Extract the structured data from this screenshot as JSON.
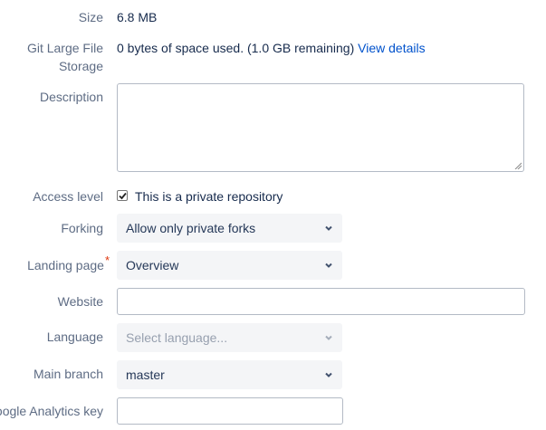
{
  "size": {
    "label": "Size",
    "value": "6.8 MB"
  },
  "lfs": {
    "label_line1": "Git Large File",
    "label_line2": "Storage",
    "value": "0 bytes of space used. (1.0 GB remaining)",
    "link": "View details"
  },
  "description": {
    "label": "Description",
    "value": ""
  },
  "access_level": {
    "label": "Access level",
    "checkbox_label": "This is a private repository",
    "checked": true
  },
  "forking": {
    "label": "Forking",
    "selected": "Allow only private forks"
  },
  "landing_page": {
    "label": "Landing page",
    "required_mark": "*",
    "selected": "Overview"
  },
  "website": {
    "label": "Website",
    "value": ""
  },
  "language": {
    "label": "Language",
    "placeholder": "Select language..."
  },
  "main_branch": {
    "label": "Main branch",
    "selected": "master"
  },
  "analytics": {
    "label": "Google Analytics key",
    "value": ""
  },
  "colors": {
    "link": "#0052cc",
    "label": "#5e6c84",
    "required": "#de350b",
    "select_bg": "#f4f5f7"
  }
}
